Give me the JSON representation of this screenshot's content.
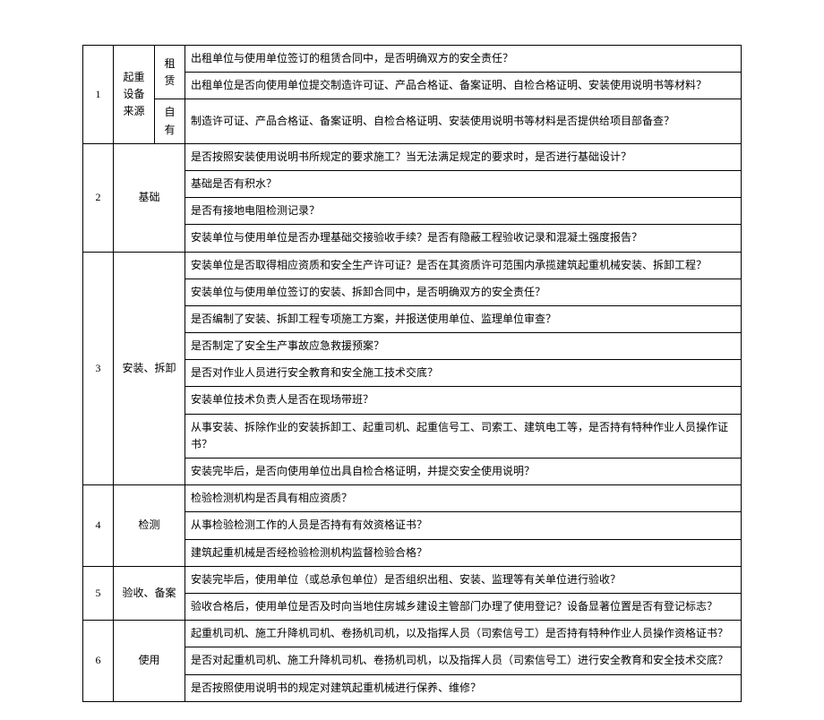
{
  "rows": [
    {
      "num": "1",
      "category": "起重设备来源",
      "subcat": "租赁",
      "items": [
        "出租单位与使用单位签订的租赁合同中，是否明确双方的安全责任？",
        "出租单位是否向使用单位提交制造许可证、产品合格证、备案证明、自检合格证明、安装使用说明书等材料？"
      ]
    },
    {
      "subcat": "自有",
      "items": [
        "制造许可证、产品合格证、备案证明、自检合格证明、安装使用说明书等材料是否提供给项目部备查？"
      ]
    },
    {
      "num": "2",
      "category": "基础",
      "items": [
        "是否按照安装使用说明书所规定的要求施工？当无法满足规定的要求时，是否进行基础设计？",
        "基础是否有积水？",
        "是否有接地电阻检测记录？",
        "安装单位与使用单位是否办理基础交接验收手续？是否有隐蔽工程验收记录和混凝土强度报告？"
      ]
    },
    {
      "num": "3",
      "category": "安装、拆卸",
      "items": [
        "安装单位是否取得相应资质和安全生产许可证？是否在其资质许可范围内承揽建筑起重机械安装、拆卸工程？",
        "安装单位与使用单位签订的安装、拆卸合同中，是否明确双方的安全责任？",
        "是否编制了安装、拆卸工程专项施工方案，并报送使用单位、监理单位审查？",
        "是否制定了安全生产事故应急救援预案？",
        "是否对作业人员进行安全教育和安全施工技术交底？",
        "安装单位技术负责人是否在现场带班？",
        "从事安装、拆除作业的安装拆卸工、起重司机、起重信号工、司索工、建筑电工等，是否持有特种作业人员操作证书？",
        "安装完毕后，是否向使用单位出具自检合格证明，并提交安全使用说明？"
      ]
    },
    {
      "num": "4",
      "category": "检测",
      "items": [
        "检验检测机构是否具有相应资质？",
        "从事检验检测工作的人员是否持有有效资格证书？",
        "建筑起重机械是否经检验检测机构监督检验合格？"
      ]
    },
    {
      "num": "5",
      "category": "验收、备案",
      "items": [
        "安装完毕后，使用单位（或总承包单位）是否组织出租、安装、监理等有关单位进行验收？",
        "验收合格后，使用单位是否及时向当地住房城乡建设主管部门办理了使用登记？设备显著位置是否有登记标志？"
      ]
    },
    {
      "num": "6",
      "category": "使用",
      "items": [
        "起重机司机、施工升降机司机、卷扬机司机，以及指挥人员（司索信号工）是否持有特种作业人员操作资格证书？",
        "是否对起重机司机、施工升降机司机、卷扬机司机，以及指挥人员（司索信号工）进行安全教育和安全技术交底？",
        "是否按照使用说明书的规定对建筑起重机械进行保养、维修？"
      ]
    }
  ]
}
